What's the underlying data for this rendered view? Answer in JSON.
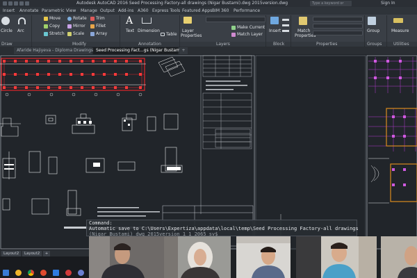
{
  "window": {
    "title": "Autodesk AutoCAD 2016   Seed Processing Factory-all drawings (Nigar Bustami).dwg 2015version.dwg",
    "search_placeholder": "Type a keyword or phrase",
    "sign_in": "Sign In"
  },
  "ribbon_tabs": [
    "Insert",
    "Annotate",
    "Parametric",
    "View",
    "Manage",
    "Output",
    "Add-ins",
    "A360",
    "Express Tools",
    "Featured Apps",
    "BIM 360",
    "Performance"
  ],
  "ribbon": {
    "draw": {
      "circle": "Circle",
      "arc": "Arc"
    },
    "modify": {
      "move": "Move",
      "rotate": "Rotate",
      "trim": "Trim",
      "copy": "Copy",
      "mirror": "Mirror",
      "fillet": "Fillet",
      "stretch": "Stretch",
      "scale": "Scale",
      "array": "Array"
    },
    "annotation": {
      "text": "Text",
      "dimension": "Dimension",
      "table": "Table"
    },
    "layers": {
      "layer_properties_1": "Layer",
      "layer_properties_2": "Properties",
      "make_current": "Make Current",
      "match_layer": "Match Layer"
    },
    "block": {
      "insert": "Insert"
    },
    "properties": {
      "match_1": "Match",
      "match_2": "Properties"
    },
    "groups": {
      "group": "Group"
    },
    "utilities": {
      "measure": "Measure"
    },
    "panel_titles": {
      "draw": "Draw",
      "modify": "Modify",
      "annotation": "Annotation",
      "layers": "Layers",
      "block": "Block",
      "properties": "Properties",
      "groups": "Groups",
      "utilities": "Utilities"
    }
  },
  "file_tabs": [
    {
      "label": "Afaride Hajiyeva - Diploma Drawings*",
      "active": false
    },
    {
      "label": "Seed Processing Fact...gs (Nigar Bustami)*",
      "active": true
    }
  ],
  "command_line": {
    "label": "Command:",
    "line2": "Automatic save to C:\\Users\\Expertiza\\appdata\\local\\temp\\Seed Processing Factory-all drawings",
    "line3": "(Nigar Bustami) dwg 2015version 1 1 2065 sv$"
  },
  "layout_tabs": [
    "Layout2",
    "Layout2"
  ],
  "colors": {
    "canvas": "#21252a",
    "ribbon": "#3a3f46",
    "accent_red": "#e0262c",
    "accent_orange": "#d98a1e",
    "accent_magenta": "#b43ad0"
  }
}
